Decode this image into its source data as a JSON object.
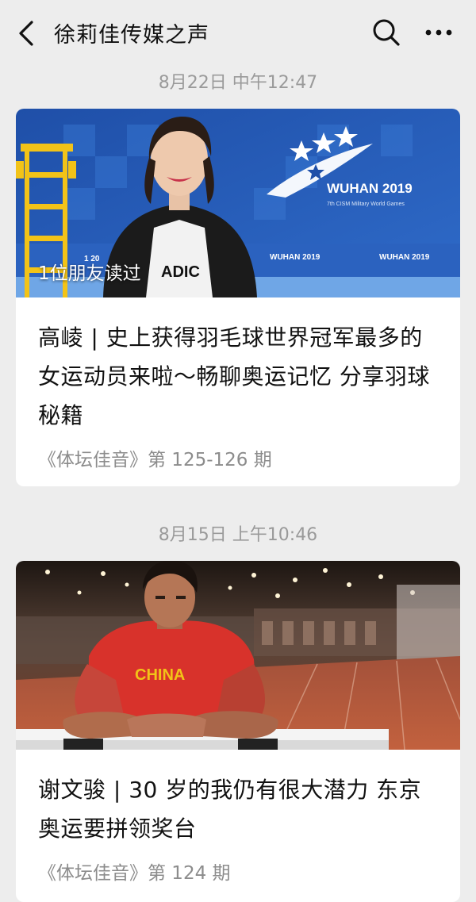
{
  "header": {
    "title": "徐莉佳传媒之声",
    "back_icon": "chevron-left-icon",
    "search_icon": "search-icon",
    "more_icon": "more-dots-icon"
  },
  "articles": [
    {
      "date": "8月22日 中午12:47",
      "read_badge": "1位朋友读过",
      "image_text": {
        "brand": "WUHAN 2019",
        "games": "7th CISM Military World Games",
        "strip1": "WUHAN 2019",
        "strip2": "WUHAN 2019",
        "left_strip": "1 20",
        "shirt": "ADIC"
      },
      "headline": "高崚 | 史上获得羽毛球世界冠军最多的女运动员来啦～畅聊奥运记忆 分享羽球秘籍",
      "subtitle": "《体坛佳音》第 125-126 期"
    },
    {
      "date": "8月15日 上午10:46",
      "image_text": {
        "shirt": "CHINA"
      },
      "headline": "谢文骏 | 30 岁的我仍有很大潜力 东京奥运要拼领奖台",
      "subtitle": "《体坛佳音》第 124 期"
    }
  ],
  "colors": {
    "background": "#ededed",
    "card": "#ffffff",
    "banner_blue": "#2a5fb8",
    "jersey_red": "#d8322b"
  }
}
